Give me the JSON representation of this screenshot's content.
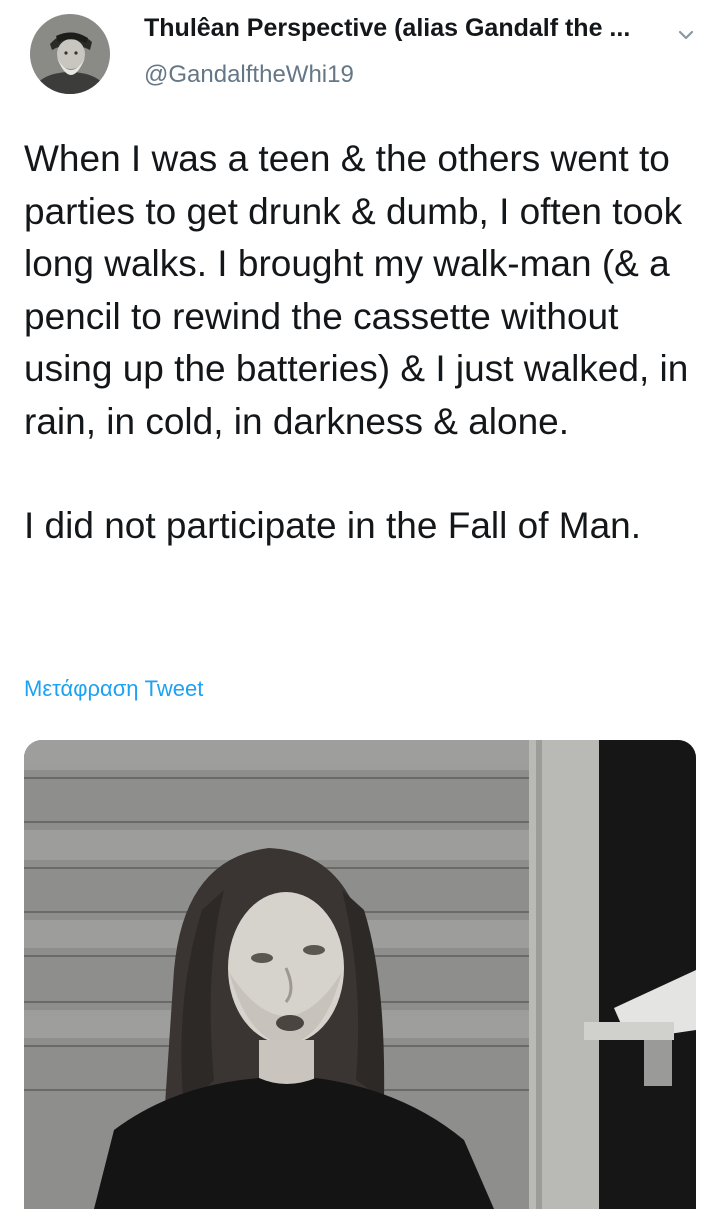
{
  "tweet": {
    "author": {
      "display_name": "Thulêan Perspective (alias Gandalf the ...",
      "handle": "@GandalftheWhi19",
      "avatar_icon": "bearded-man-avatar"
    },
    "menu_icon": "chevron-down-icon",
    "paragraphs": [
      "When I was a teen & the others went to parties to get drunk & dumb, I often took long walks. I brought my walk-man (& a pencil to rewind the cassette without using up the batteries) & I just walked, in rain, in cold, in darkness & alone.",
      "I did not participate in the Fall of Man."
    ],
    "translate_label": "Μετάφραση Tweet",
    "media": {
      "type": "photo",
      "style": "black-and-white"
    }
  },
  "colors": {
    "text": "#14171a",
    "secondary_text": "#657786",
    "link": "#1da1f2",
    "background": "#ffffff"
  }
}
